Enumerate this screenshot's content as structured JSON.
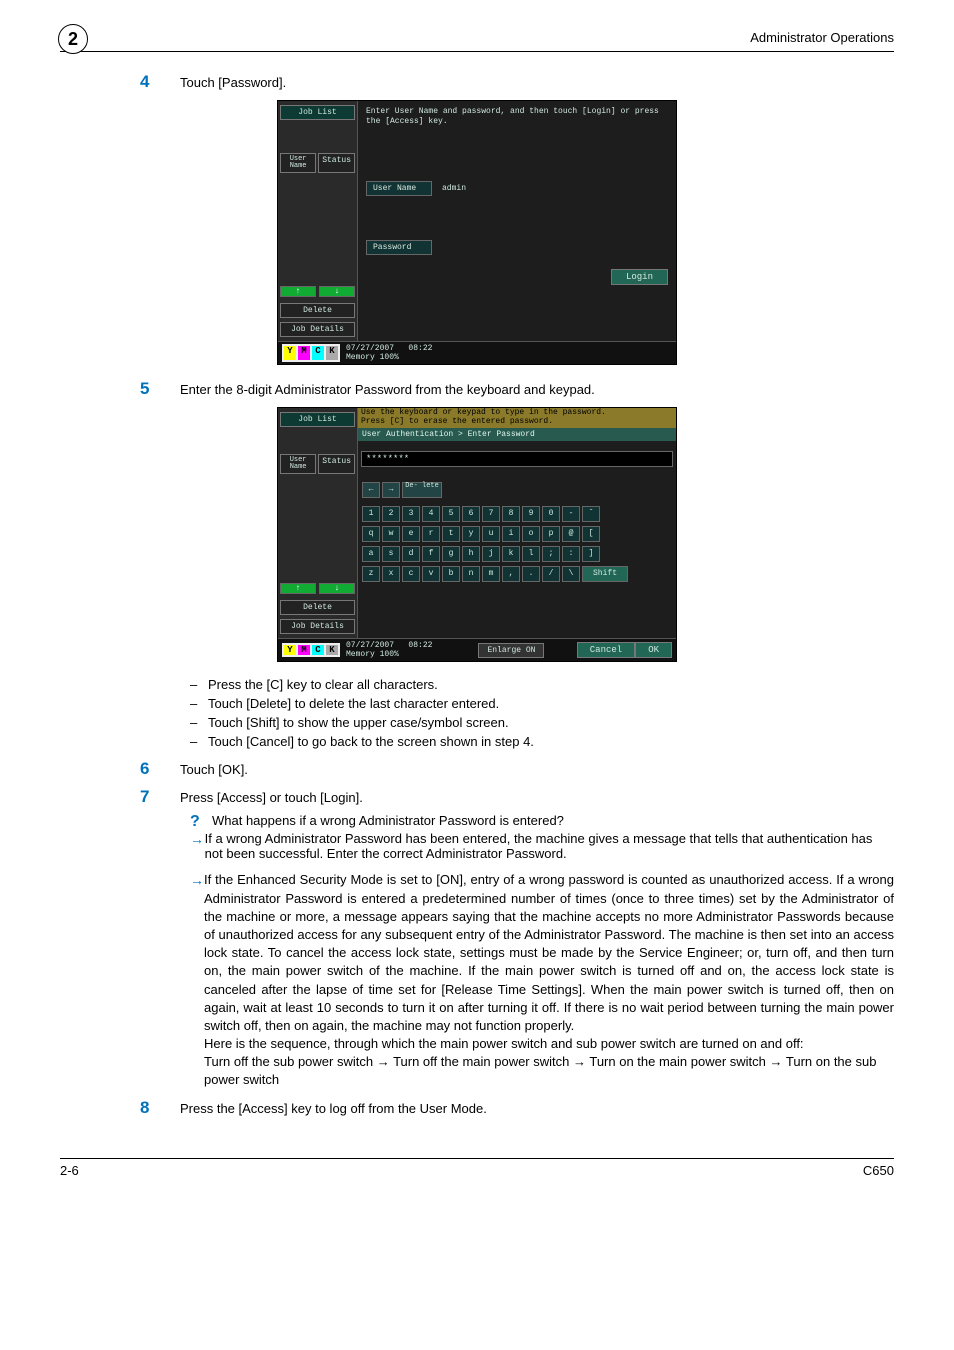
{
  "header": {
    "right": "Administrator Operations",
    "chapter_number": "2"
  },
  "steps": {
    "s4": {
      "num": "4",
      "text": "Touch [Password]."
    },
    "s5": {
      "num": "5",
      "text": "Enter the 8-digit Administrator Password from the keyboard and keypad."
    },
    "s6": {
      "num": "6",
      "text": "Touch [OK]."
    },
    "s7": {
      "num": "7",
      "text": "Press [Access] or touch [Login]."
    },
    "s8": {
      "num": "8",
      "text": "Press the [Access] key to log off from the User Mode."
    }
  },
  "ss1": {
    "joblist": "Job List",
    "instr": "Enter User Name and password, and then touch [Login] or press the [Access] key.",
    "userName_label": "User Name",
    "userName_value": "admin",
    "password_label": "Password",
    "status": "Status",
    "user": "User\nName",
    "delete": "Delete",
    "jobdetails": "Job Details",
    "login": "Login",
    "date": "07/27/2007",
    "time": "08:22",
    "mem": "Memory   100%"
  },
  "ss2": {
    "joblist": "Job List",
    "instr_l1": "Use the keyboard or keypad to type in the password.",
    "instr_l2": "Press [C] to erase the entered password.",
    "title": "User Authentication > Enter Password",
    "pw_mask": "********",
    "status": "Status",
    "user": "User\nName",
    "delete": "Delete",
    "jobdetails": "Job Details",
    "shift": "Shift",
    "enlarge": "Enlarge ON",
    "cancel": "Cancel",
    "ok": "OK",
    "date": "07/27/2007",
    "time": "08:22",
    "mem": "Memory   100%",
    "nav_left": "←",
    "nav_right": "→",
    "nav_del": "De-\nlete",
    "row1": [
      "1",
      "2",
      "3",
      "4",
      "5",
      "6",
      "7",
      "8",
      "9",
      "0",
      "-",
      "ˆ"
    ],
    "row2": [
      "q",
      "w",
      "e",
      "r",
      "t",
      "y",
      "u",
      "i",
      "o",
      "p",
      "@",
      "["
    ],
    "row3": [
      "a",
      "s",
      "d",
      "f",
      "g",
      "h",
      "j",
      "k",
      "l",
      ";",
      ":",
      "]"
    ],
    "row4": [
      "z",
      "x",
      "c",
      "v",
      "b",
      "n",
      "m",
      ",",
      ".",
      "/",
      "\\"
    ]
  },
  "bullets": {
    "b1": "Press the [C] key to clear all characters.",
    "b2": "Touch [Delete] to delete the last character entered.",
    "b3": "Touch [Shift] to show the upper case/symbol screen.",
    "b4": "Touch [Cancel] to go back to the screen shown in step 4."
  },
  "qa": {
    "q": "What happens if a wrong Administrator Password is entered?",
    "a": "If a wrong Administrator Password has been entered, the machine gives a message that tells that authentication has not been successful. Enter the correct Administrator Password."
  },
  "long_note": {
    "p1": "If the Enhanced Security Mode is set to [ON], entry of a wrong password is counted as unauthorized access. If a wrong Administrator Password is entered a predetermined number of times (once to three times) set by the Administrator of the machine or more, a message appears saying that the machine accepts no more Administrator Passwords because of unauthorized access for any subsequent entry of the Administrator Password. The machine is then set into an access lock state. To cancel the access lock state, settings must be made by the Service Engineer; or, turn off, and then turn on, the main power switch of the machine. If the main power switch is turned off and on, the access lock state is canceled after the lapse of time set for [Release Time Settings]. When the main power switch is turned off, then on again, wait at least 10 seconds to turn it on after turning it off. If there is no wait period between turning the main power switch off, then on again, the machine may not function properly.",
    "p2": "Here is the sequence, through which the main power switch and sub power switch are turned on and off:",
    "p3": "Turn off the sub power switch → Turn off the main power switch → Turn on the main power switch → Turn on the sub power switch"
  },
  "footer": {
    "left": "2-6",
    "right": "C650"
  }
}
